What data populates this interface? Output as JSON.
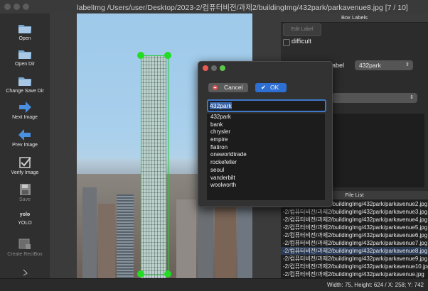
{
  "window": {
    "title": "labelImg /Users/user/Desktop/2023-2/컴퓨터비전/과제2/buildingImg/432park/parkavenue8.jpg [7 / 10]"
  },
  "toolbar": {
    "open": "Open",
    "open_dir": "Open Dir",
    "change_save_dir": "Change Save Dir",
    "next_image": "Next Image",
    "prev_image": "Prev Image",
    "verify_image": "Verify Image",
    "save": "Save",
    "format_icon_text": "yolo",
    "format": "YOLO",
    "create_rectbox": "Create RectBox"
  },
  "box_labels": {
    "header": "Box Labels",
    "edit_label": "Edit Label",
    "difficult": "difficult",
    "use_default_label_partial": "abel",
    "default_label_value": "432park"
  },
  "dialog": {
    "cancel": "Cancel",
    "ok": "OK",
    "input_value": "432park",
    "items": [
      "432park",
      "bank",
      "chrysler",
      "empire",
      "flatiron",
      "oneworldtrade",
      "rockefeller",
      "seoul",
      "vanderbilt",
      "woolworth"
    ]
  },
  "file_list": {
    "header": "File List",
    "items": [
      "-2/컴퓨터비전/과제2/buildingImg/432park/parkavenue2.jpg",
      "-2/컴퓨터비전/과제2/buildingImg/432park/parkavenue3.jpg",
      "-2/컴퓨터비전/과제2/buildingImg/432park/parkavenue4.jpg",
      "-2/컴퓨터비전/과제2/buildingImg/432park/parkavenue5.jpg",
      "-2/컴퓨터비전/과제2/buildingImg/432park/parkavenue6.jpg",
      "-2/컴퓨터비전/과제2/buildingImg/432park/parkavenue7.jpg",
      "-2/컴퓨터비전/과제2/buildingImg/432park/parkavenue8.jpg",
      "-2/컴퓨터비전/과제2/buildingImg/432park/parkavenue9.jpg",
      "-2/컴퓨터비전/과제2/buildingImg/432park/parkavenue10.jpg",
      "-2/컴퓨터비전/과제2/buildingImg/432park/parkavenue.jpg"
    ],
    "selected_index": 6
  },
  "status": {
    "text": "Width: 75, Height: 624 / X: 258; Y: 742"
  },
  "colors": {
    "accent": "#3f77c8",
    "bbox": "#2ecc40",
    "ok_button": "#2e6fd3"
  }
}
